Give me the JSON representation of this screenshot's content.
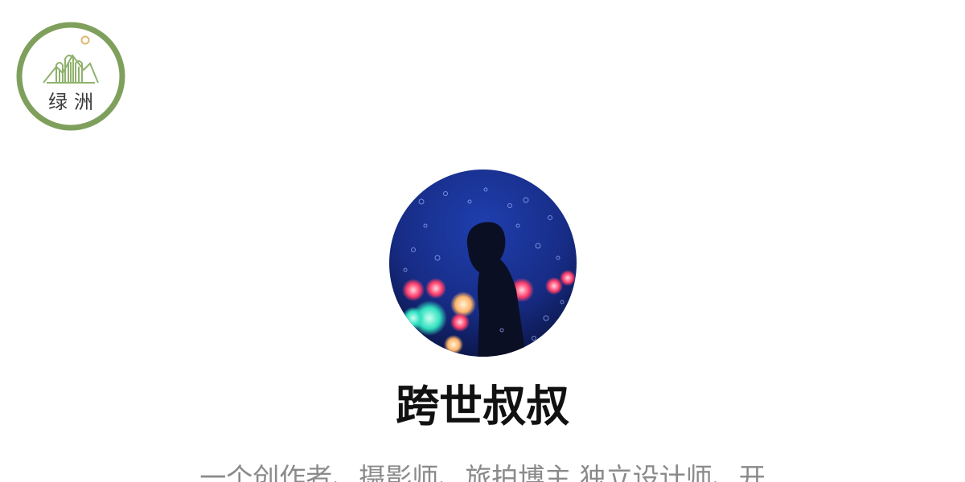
{
  "brand": {
    "logo_text": "绿洲",
    "logo_color": "#7fa05d",
    "logo_accent": "#e0b86e"
  },
  "profile": {
    "avatar_icon": "profile-avatar",
    "name": "跨世叔叔",
    "bio": "一个创作者、摄影师、旅拍博主 独立设计师、开"
  },
  "colors": {
    "background": "#ffffff",
    "name_text": "#111111",
    "bio_text": "#8a8a8a"
  }
}
